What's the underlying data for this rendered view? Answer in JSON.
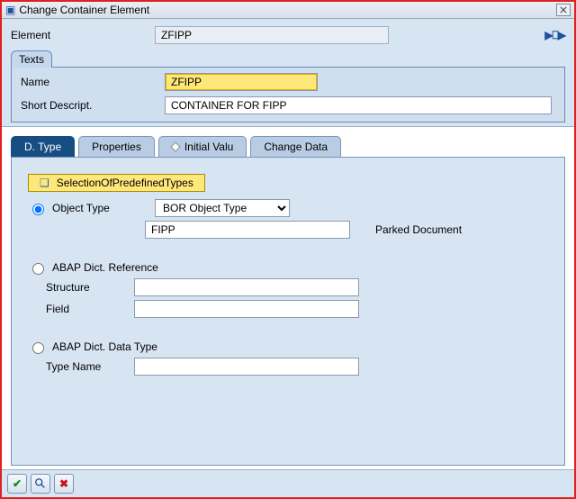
{
  "titlebar": {
    "title": "Change Container Element"
  },
  "header": {
    "element_label": "Element",
    "element_value": "ZFIPP"
  },
  "texts": {
    "tab_label": "Texts",
    "name_label": "Name",
    "name_value": "ZFIPP",
    "desc_label": "Short Descript.",
    "desc_value": "CONTAINER FOR FIPP"
  },
  "tabs": {
    "dtype": "D. Type",
    "properties": "Properties",
    "initial": "Initial Valu",
    "change": "Change Data"
  },
  "dtype": {
    "predef_btn": "SelectionOfPredefinedTypes",
    "object_type_label": "Object Type",
    "object_type_select": "BOR Object Type",
    "object_type_value": "FIPP",
    "object_type_desc": "Parked Document",
    "abap_ref_label": "ABAP Dict. Reference",
    "structure_label": "Structure",
    "structure_value": "",
    "field_label": "Field",
    "field_value": "",
    "abap_dt_label": "ABAP Dict. Data Type",
    "typename_label": "Type Name",
    "typename_value": ""
  }
}
